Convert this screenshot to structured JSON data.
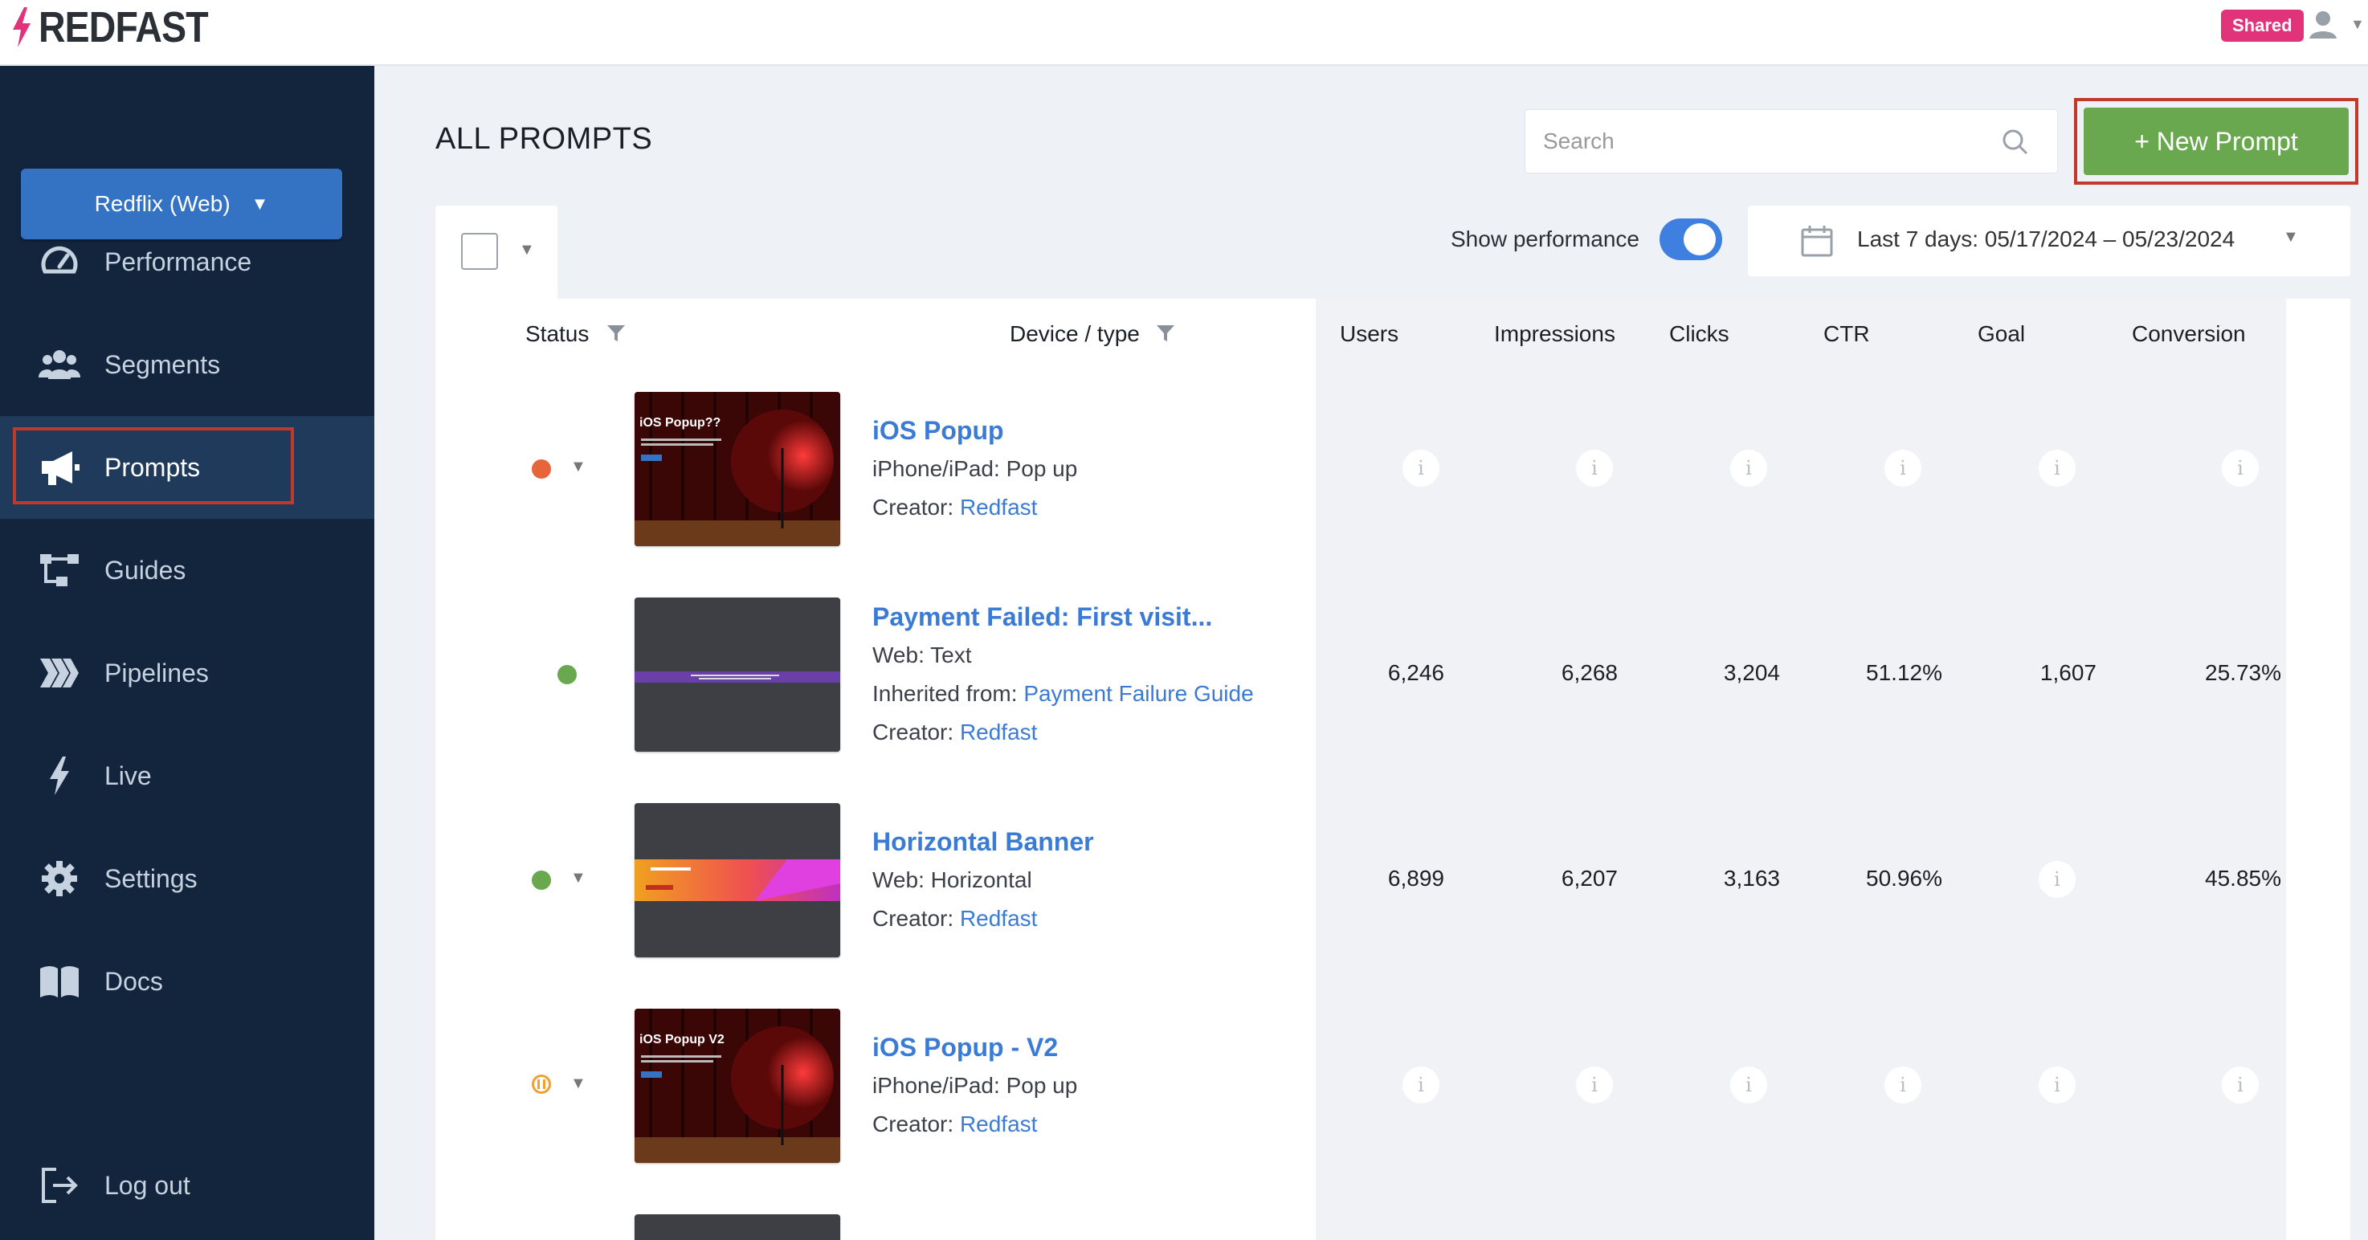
{
  "app": {
    "logo_text": "REDFAST",
    "shared_badge": "Shared"
  },
  "sidebar": {
    "app_selector": "Redflix (Web)",
    "items": [
      {
        "label": "Performance",
        "icon": "gauge-icon"
      },
      {
        "label": "Segments",
        "icon": "users-icon"
      },
      {
        "label": "Prompts",
        "icon": "megaphone-icon",
        "active": true
      },
      {
        "label": "Guides",
        "icon": "flow-icon"
      },
      {
        "label": "Pipelines",
        "icon": "pipelines-icon"
      },
      {
        "label": "Live",
        "icon": "bolt-icon"
      },
      {
        "label": "Settings",
        "icon": "gear-icon"
      },
      {
        "label": "Docs",
        "icon": "book-icon"
      }
    ],
    "logout": "Log out"
  },
  "header": {
    "title": "ALL PROMPTS",
    "search_placeholder": "Search",
    "new_prompt": "+ New Prompt"
  },
  "toolbar": {
    "show_performance": "Show performance",
    "show_performance_on": true,
    "date_range": "Last 7 days: 05/17/2024 – 05/23/2024"
  },
  "table": {
    "columns": {
      "status": "Status",
      "device_type": "Device / type",
      "users": "Users",
      "impressions": "Impressions",
      "clicks": "Clicks",
      "ctr": "CTR",
      "goal": "Goal",
      "conversion": "Conversion"
    },
    "rows": [
      {
        "name": "iOS Popup",
        "thumb_title": "iOS Popup??",
        "type": "iPhone/iPad: Pop up",
        "creator_label": "Creator: ",
        "creator": "Redfast",
        "status_color": "#e8643a",
        "metrics": {
          "users": "",
          "impressions": "",
          "clicks": "",
          "ctr": "",
          "goal": "",
          "conversion": ""
        }
      },
      {
        "name": "Payment Failed: First visit...",
        "type": "Web: Text",
        "inherited_label": "Inherited from: ",
        "inherited": "Payment Failure Guide",
        "creator_label": "Creator: ",
        "creator": "Redfast",
        "status_color": "#6aa84f",
        "metrics": {
          "users": "6,246",
          "impressions": "6,268",
          "clicks": "3,204",
          "ctr": "51.12%",
          "goal": "1,607",
          "conversion": "25.73%"
        }
      },
      {
        "name": "Horizontal Banner",
        "type": "Web: Horizontal",
        "creator_label": "Creator: ",
        "creator": "Redfast",
        "status_color": "#6aa84f",
        "metrics": {
          "users": "6,899",
          "impressions": "6,207",
          "clicks": "3,163",
          "ctr": "50.96%",
          "goal": "",
          "conversion": "45.85%"
        }
      },
      {
        "name": "iOS Popup - V2",
        "thumb_title": "iOS Popup V2",
        "type": "iPhone/iPad: Pop up",
        "creator_label": "Creator: ",
        "creator": "Redfast",
        "status_color": "#f0a030",
        "metrics": {
          "users": "",
          "impressions": "",
          "clicks": "",
          "ctr": "",
          "goal": "",
          "conversion": ""
        }
      }
    ]
  },
  "colors": {
    "sidebar_bg": "#12253d",
    "primary": "#3472c4",
    "success": "#6aa84f",
    "link": "#3a7bd5",
    "badge": "#e0337a"
  }
}
